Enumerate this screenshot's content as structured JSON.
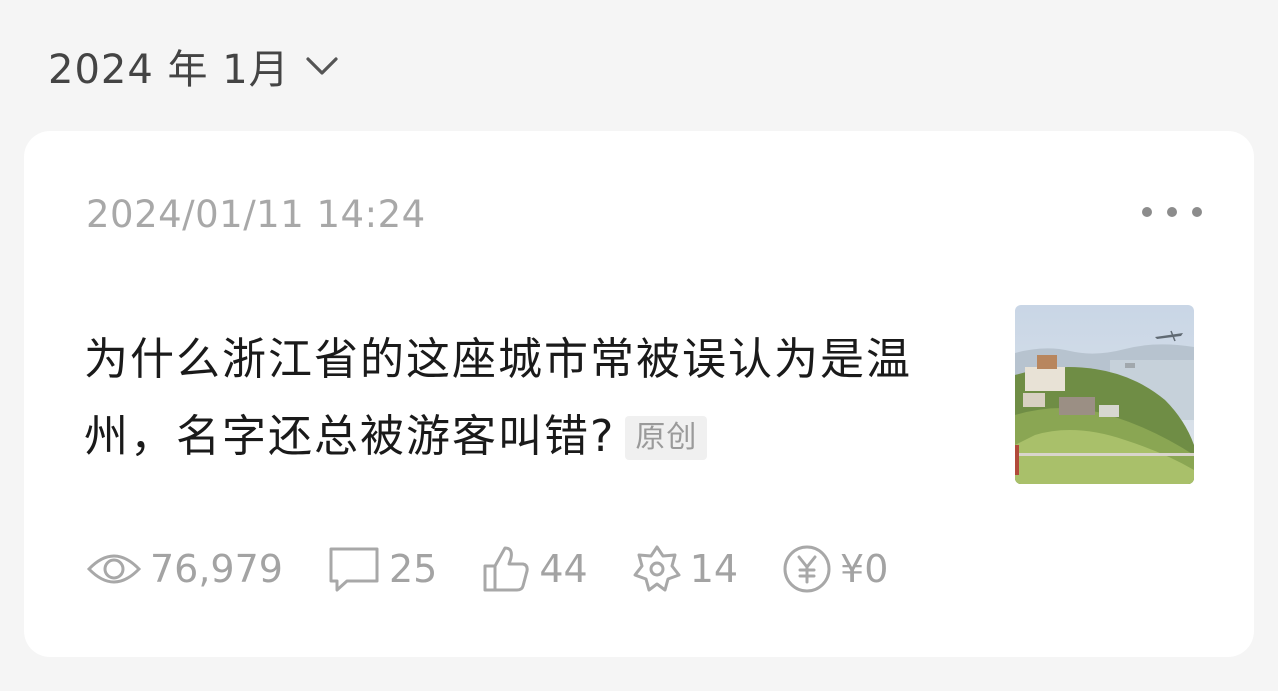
{
  "header": {
    "month_label": "2024 年 1月",
    "chevron_icon": "chevron-down-icon"
  },
  "article": {
    "timestamp": "2024/01/11 14:24",
    "title": "为什么浙江省的这座城市常被误认为是温州，名字还总被游客叫错?",
    "badge": "原创",
    "more_icon": "more-options-icon",
    "thumbnail": "coastal-town-photo",
    "stats": {
      "views": "76,979",
      "comments": "25",
      "likes": "44",
      "shares": "14",
      "earnings": "¥0"
    }
  },
  "colors": {
    "background": "#f5f5f5",
    "card": "#ffffff",
    "title_text": "#1a1a1a",
    "muted_text": "#a3a3a3"
  }
}
